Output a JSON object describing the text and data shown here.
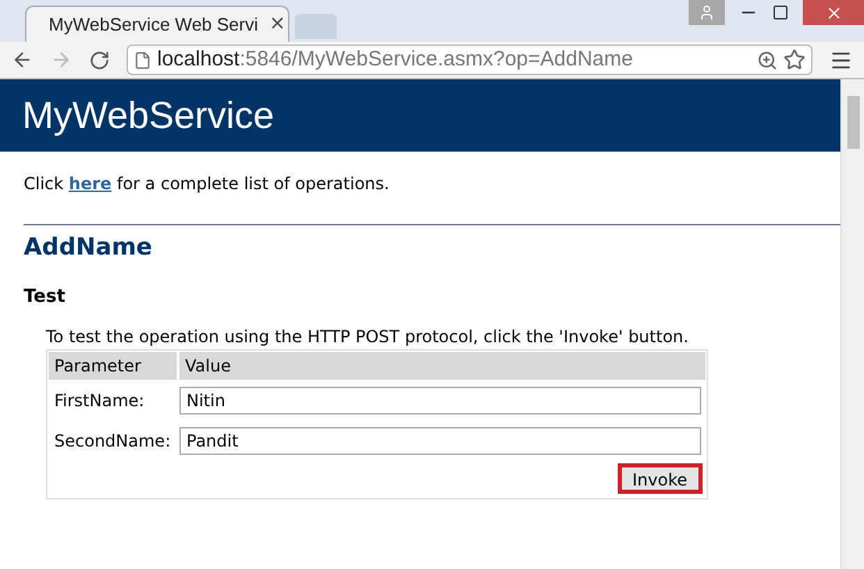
{
  "browser": {
    "tab_title": "MyWebService Web Servi",
    "tab_close": "×",
    "address_host": "localhost",
    "address_path": ":5846/MyWebService.asmx?op=AddName"
  },
  "header": {
    "title": "MyWebService"
  },
  "intro": "Click **here** for a complete list of operations.",
  "operation": {
    "title": "AddName",
    "section": "Test",
    "description": "To test the operation using the HTTP POST protocol, click the 'Invoke' button.",
    "columns": [
      "Parameter",
      "Value"
    ],
    "rows": [
      {
        "label": "FirstName:",
        "value": "Nitin"
      },
      {
        "label": "SecondName:",
        "value": "Pandit"
      }
    ],
    "button": {
      "label": "Invoke",
      "highlighted": true
    }
  }
}
